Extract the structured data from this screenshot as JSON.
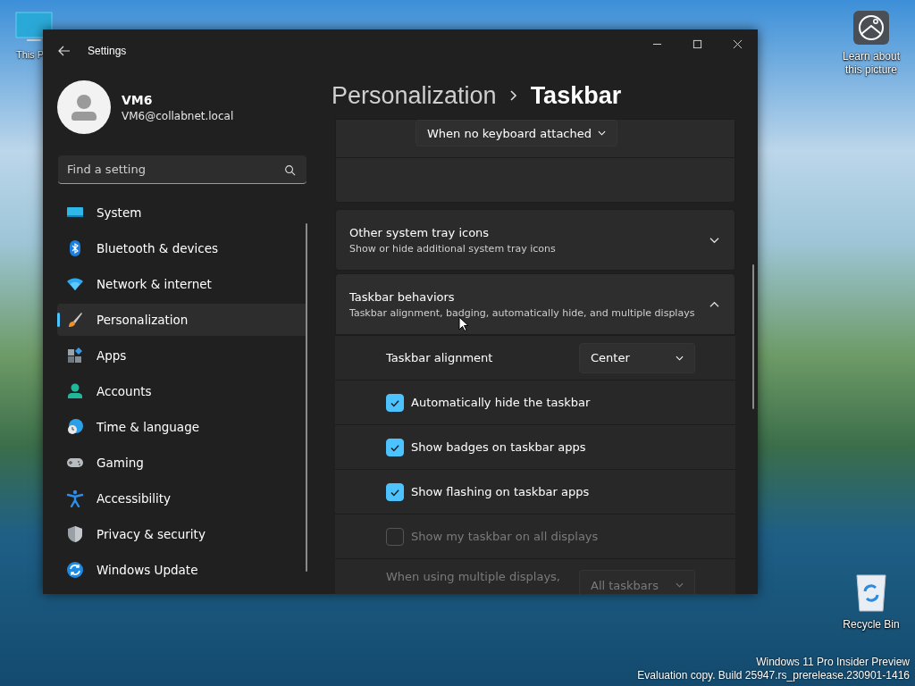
{
  "desktop": {
    "icons": [
      {
        "kind": "pc",
        "label": "This P"
      },
      {
        "kind": "spotlight",
        "label": "Learn about this picture"
      },
      {
        "kind": "recycle",
        "label": "Recycle Bin"
      }
    ],
    "watermark": [
      "Windows 11 Pro Insider Preview",
      "Evaluation copy. Build 25947.rs_prerelease.230901-1416"
    ]
  },
  "window": {
    "title": "Settings"
  },
  "account": {
    "name": "VM6",
    "email": "VM6@collabnet.local"
  },
  "search": {
    "placeholder": "Find a setting"
  },
  "sidebar": {
    "items": [
      {
        "kind": "system",
        "label": "System",
        "selected": false
      },
      {
        "kind": "bluetooth",
        "label": "Bluetooth & devices",
        "selected": false
      },
      {
        "kind": "network",
        "label": "Network & internet",
        "selected": false
      },
      {
        "kind": "personalization",
        "label": "Personalization",
        "selected": true
      },
      {
        "kind": "apps",
        "label": "Apps",
        "selected": false
      },
      {
        "kind": "accounts",
        "label": "Accounts",
        "selected": false
      },
      {
        "kind": "time",
        "label": "Time & language",
        "selected": false
      },
      {
        "kind": "gaming",
        "label": "Gaming",
        "selected": false
      },
      {
        "kind": "accessibility",
        "label": "Accessibility",
        "selected": false
      },
      {
        "kind": "privacy",
        "label": "Privacy & security",
        "selected": false
      },
      {
        "kind": "update",
        "label": "Windows Update",
        "selected": false
      }
    ]
  },
  "breadcrumb": {
    "parent": "Personalization",
    "current": "Taskbar"
  },
  "sections": [
    {
      "kind": "partial",
      "dropdown": "When no keyboard attached"
    },
    {
      "kind": "expander",
      "title": "Other system tray icons",
      "subtitle": "Show or hide additional system tray icons",
      "expanded": false
    },
    {
      "kind": "expander",
      "title": "Taskbar behaviors",
      "subtitle": "Taskbar alignment, badging, automatically hide, and multiple displays",
      "expanded": true,
      "rows": [
        {
          "kind": "dropdown",
          "label": "Taskbar alignment",
          "value": "Center",
          "disabled": false
        },
        {
          "kind": "checkbox",
          "label": "Automatically hide the taskbar",
          "checked": true,
          "disabled": false
        },
        {
          "kind": "checkbox",
          "label": "Show badges on taskbar apps",
          "checked": true,
          "disabled": false
        },
        {
          "kind": "checkbox",
          "label": "Show flashing on taskbar apps",
          "checked": true,
          "disabled": false
        },
        {
          "kind": "checkbox",
          "label": "Show my taskbar on all displays",
          "checked": false,
          "disabled": true
        },
        {
          "kind": "dropdown",
          "label": "When using multiple displays,",
          "value": "All taskbars",
          "disabled": true
        }
      ]
    }
  ]
}
